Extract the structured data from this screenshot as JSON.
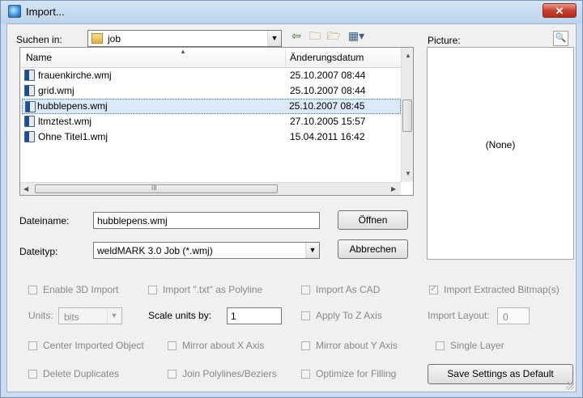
{
  "window": {
    "title": "Import...",
    "close_label": "✕"
  },
  "lookin": {
    "label": "Suchen in:",
    "value": "job"
  },
  "picture": {
    "label": "Picture:",
    "placeholder": "(None)"
  },
  "filelist": {
    "col_name": "Name",
    "col_date": "Änderungsdatum",
    "files": [
      {
        "name": "frauenkirche.wmj",
        "date": "25.10.2007 08:44"
      },
      {
        "name": "grid.wmj",
        "date": "25.10.2007 08:44"
      },
      {
        "name": "hubblepens.wmj",
        "date": "25.10.2007 08:45"
      },
      {
        "name": "ltmztest.wmj",
        "date": "27.10.2005 15:57"
      },
      {
        "name": "Ohne Titel1.wmj",
        "date": "15.04.2011 16:42"
      }
    ],
    "selected_index": 2,
    "hscroll_thumb_label": "III"
  },
  "filename": {
    "label": "Dateiname:",
    "value": "hubblepens.wmj"
  },
  "filetype": {
    "label": "Dateityp:",
    "value": "weldMARK 3.0 Job (*.wmj)"
  },
  "buttons": {
    "open": "Öffnen",
    "cancel": "Abbrechen",
    "save_settings": "Save Settings as Default"
  },
  "options": {
    "enable_3d": "Enable 3D Import",
    "import_txt": "Import \".txt\" as Polyline",
    "import_cad": "Import As CAD",
    "import_bitmaps": "Import Extracted Bitmap(s)",
    "units_label": "Units:",
    "units_value": "bits",
    "scale_label": "Scale units by:",
    "scale_value": "1",
    "apply_z": "Apply To Z Axis",
    "import_layout_label": "Import Layout:",
    "import_layout_value": "0",
    "center_object": "Center Imported Object",
    "mirror_x": "Mirror about X Axis",
    "mirror_y": "Mirror about Y Axis",
    "single_layer": "Single Layer",
    "delete_duplicates": "Delete Duplicates",
    "join_polylines": "Join Polylines/Beziers",
    "optimize_filling": "Optimize for Filling"
  },
  "icons": [
    "app-icon",
    "folder-icon",
    "back-arrow-icon",
    "up-folder-icon",
    "new-folder-icon",
    "view-menu-icon",
    "file-icon",
    "preview-icon",
    "close-icon"
  ]
}
